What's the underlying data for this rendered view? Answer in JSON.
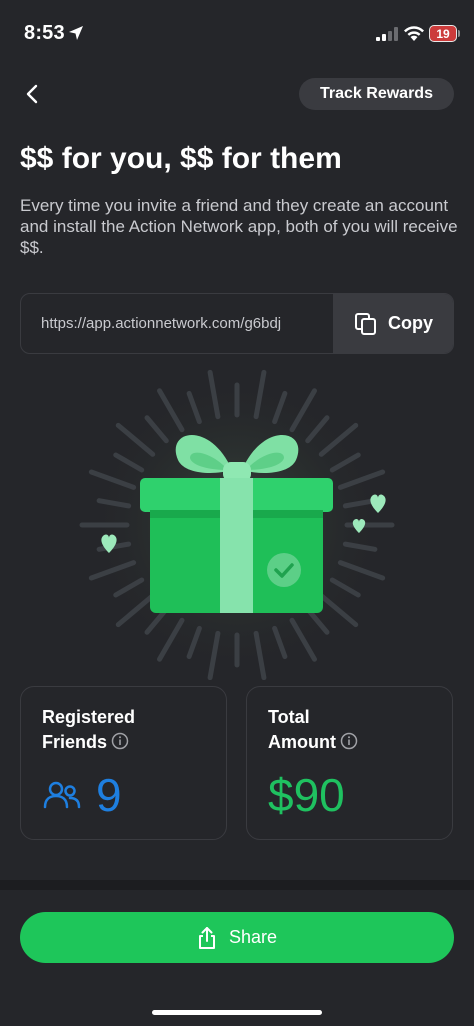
{
  "status_bar": {
    "time": "8:53",
    "battery": "19"
  },
  "header": {
    "track_rewards_label": "Track Rewards"
  },
  "title": "$$ for you, $$ for them",
  "description": "Every time you invite a friend and they create an account and install the Action Network app, both of you will receive $$.",
  "referral": {
    "link": "https://app.actionnetwork.com/g6bdj",
    "copy_label": "Copy"
  },
  "stats": {
    "friends": {
      "label_line1": "Registered",
      "label_line2": "Friends",
      "value": "9"
    },
    "amount": {
      "label_line1": "Total",
      "label_line2": "Amount",
      "value": "$90"
    }
  },
  "share_label": "Share",
  "colors": {
    "background": "#25262a",
    "accent_green": "#1ec65a",
    "friends_blue": "#1e7fe0",
    "amount_green": "#1fc160"
  }
}
